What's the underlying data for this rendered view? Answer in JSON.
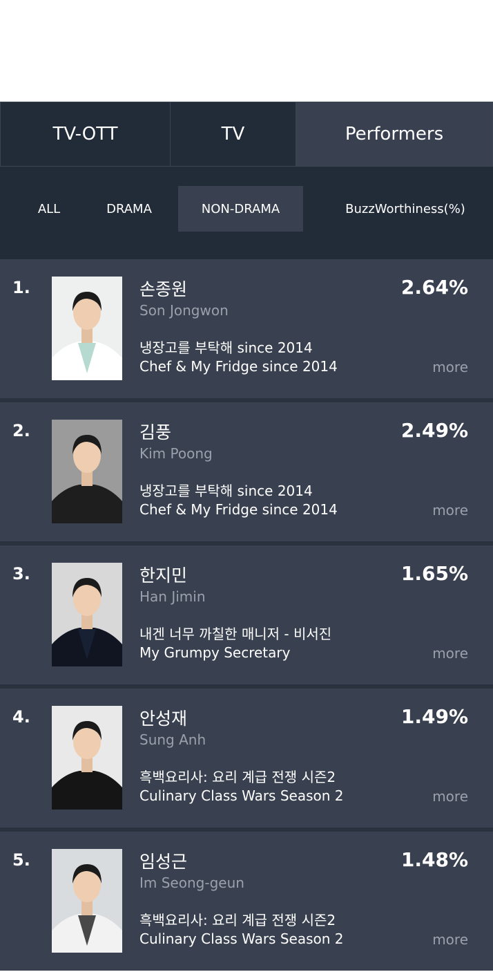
{
  "tabs": [
    {
      "label": "TV-OTT"
    },
    {
      "label": "TV"
    },
    {
      "label": "Performers"
    }
  ],
  "filters": {
    "all": "ALL",
    "drama": "DRAMA",
    "non_drama": "NON-DRAMA",
    "metric": "BuzzWorthiness(%)"
  },
  "rankings": [
    {
      "rank": "1.",
      "name_kr": "손종원",
      "name_en": "Son Jongwon",
      "show_kr": "냉장고를 부탁해 since 2014",
      "show_en": "Chef & My Fridge since 2014",
      "percent": "2.64%",
      "more": "more",
      "photo_bg": "#eef0f0",
      "clothes": "#ffffff",
      "accent": "#a9d3c8"
    },
    {
      "rank": "2.",
      "name_kr": "김풍",
      "name_en": "Kim Poong",
      "show_kr": "냉장고를 부탁해 since 2014",
      "show_en": "Chef & My Fridge since 2014",
      "percent": "2.49%",
      "more": "more",
      "photo_bg": "#9b9b9b",
      "clothes": "#1e1e1e",
      "accent": "#1e1e1e"
    },
    {
      "rank": "3.",
      "name_kr": "한지민",
      "name_en": "Han Jimin",
      "show_kr": "내겐 너무 까칠한 매니저 - 비서진",
      "show_en": "My Grumpy Secretary",
      "percent": "1.65%",
      "more": "more",
      "photo_bg": "#d8d8d8",
      "clothes": "#111522",
      "accent": "#1a2236"
    },
    {
      "rank": "4.",
      "name_kr": "안성재",
      "name_en": "Sung Anh",
      "show_kr": "흑백요리사: 요리 계급 전쟁 시즌2",
      "show_en": "Culinary Class Wars Season 2",
      "percent": "1.49%",
      "more": "more",
      "photo_bg": "#e9e9e9",
      "clothes": "#151515",
      "accent": "#151515"
    },
    {
      "rank": "5.",
      "name_kr": "임성근",
      "name_en": "Im Seong-geun",
      "show_kr": "흑백요리사: 요리 계급 전쟁 시즌2",
      "show_en": "Culinary Class Wars Season 2",
      "percent": "1.48%",
      "more": "more",
      "photo_bg": "#d9dcdf",
      "clothes": "#f2f2f2",
      "accent": "#2a2a2a"
    }
  ]
}
